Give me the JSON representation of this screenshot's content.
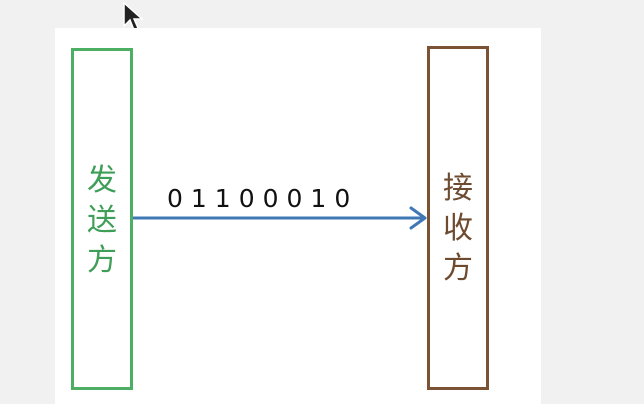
{
  "diagram": {
    "sender_label": "发送方",
    "receiver_label": "接收方",
    "bit_string": "01100010"
  },
  "colors": {
    "sender_border": "#4caf63",
    "sender_text": "#3f9e57",
    "receiver_border": "#7b5233",
    "receiver_text": "#6e4a2f",
    "arrow": "#3f78b5"
  },
  "icons": {
    "cursor": "mouse-pointer-icon"
  }
}
